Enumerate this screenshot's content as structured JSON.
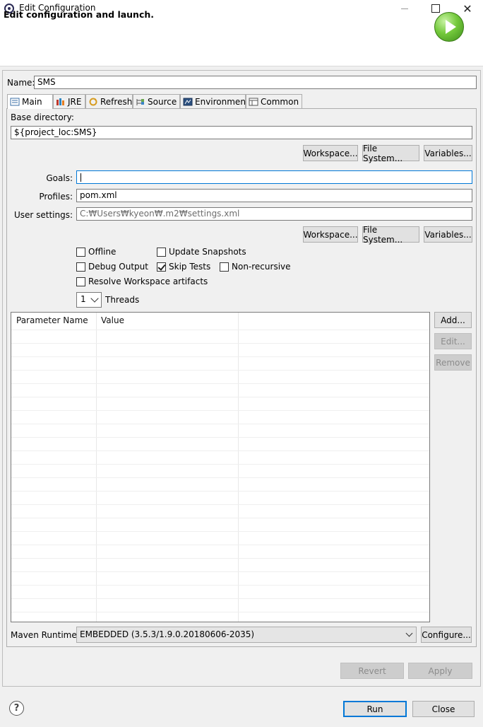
{
  "window": {
    "title": "Edit Configuration"
  },
  "header": {
    "title": "Edit configuration and launch."
  },
  "name": {
    "label": "Name:",
    "value": "SMS"
  },
  "tabs": [
    {
      "label": "Main",
      "icon": "main-tab-icon",
      "active": true
    },
    {
      "label": "JRE",
      "icon": "jre-icon"
    },
    {
      "label": "Refresh",
      "icon": "refresh-icon"
    },
    {
      "label": "Source",
      "icon": "source-icon"
    },
    {
      "label": "Environment",
      "icon": "environment-icon"
    },
    {
      "label": "Common",
      "icon": "common-icon"
    }
  ],
  "main": {
    "base_dir_label": "Base directory:",
    "base_dir_value": "${project_loc:SMS}",
    "workspace_label": "Workspace...",
    "filesystem_label": "File System...",
    "variables_label": "Variables...",
    "goals_label": "Goals:",
    "goals_value": "",
    "profiles_label": "Profiles:",
    "profiles_value": "pom.xml",
    "user_settings_label": "User settings:",
    "user_settings_placeholder": "C:₩Users₩kyeon₩.m2₩settings.xml",
    "offline_label": "Offline",
    "update_snapshots_label": "Update Snapshots",
    "debug_output_label": "Debug Output",
    "skip_tests_label": "Skip Tests",
    "non_recursive_label": "Non-recursive",
    "resolve_ws_label": "Resolve Workspace artifacts",
    "threads_value": "1",
    "threads_label": "Threads",
    "table": {
      "columns": [
        "Parameter Name",
        "Value"
      ],
      "rows": []
    },
    "add_label": "Add...",
    "edit_label": "Edit...",
    "remove_label": "Remove",
    "runtime_label": "Maven Runtime:",
    "runtime_value": "EMBEDDED (3.5.3/1.9.0.20180606-2035)",
    "configure_label": "Configure..."
  },
  "footer": {
    "revert_label": "Revert",
    "apply_label": "Apply",
    "run_label": "Run",
    "close_label": "Close",
    "help_glyph": "?"
  }
}
